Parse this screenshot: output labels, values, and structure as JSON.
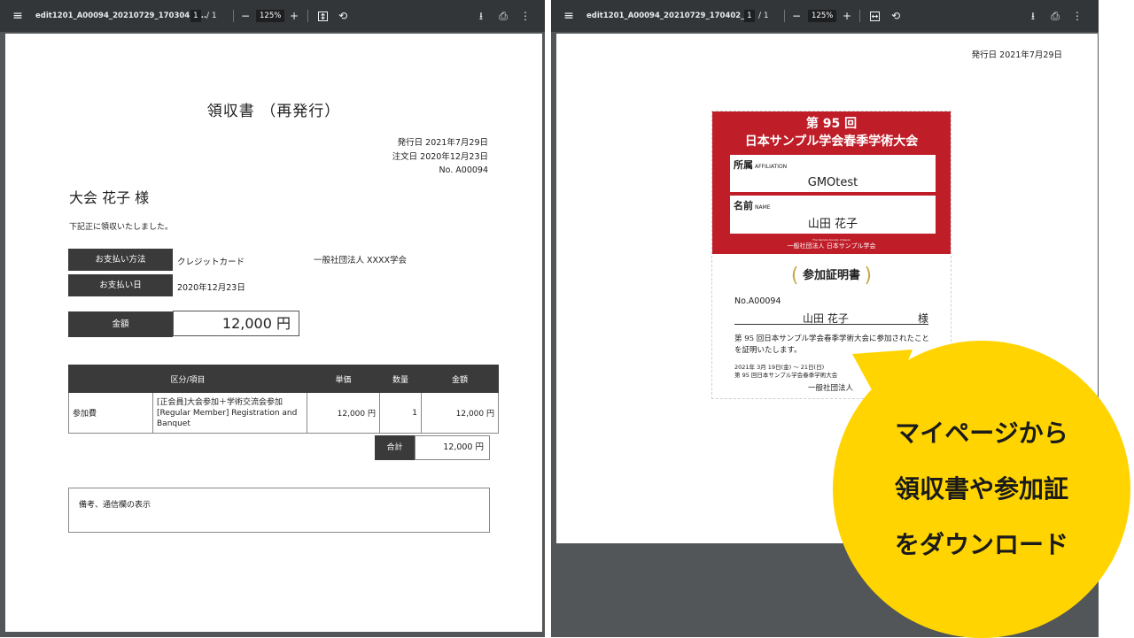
{
  "viewer_left": {
    "filename": "edit1201_A00094_20210729_170304.p...",
    "page_current": "1",
    "page_total": "/  1",
    "zoom": "125%",
    "icons": [
      "menu-icon",
      "zoom-out-icon",
      "zoom-in-icon",
      "fit-page-icon",
      "rotate-icon",
      "download-icon",
      "print-icon",
      "more-icon"
    ]
  },
  "viewer_right": {
    "filename": "edit1201_A00094_20210729_170402_...",
    "page_current": "1",
    "page_total": "/  1",
    "zoom": "125%"
  },
  "receipt": {
    "title": "領収書 （再発行）",
    "issue_date": "発行日 2021年7月29日",
    "order_date": "注文日 2020年12月23日",
    "number": "No. A00094",
    "recipient": "大会 花子 様",
    "note": "下記正に領収いたしました。",
    "payment_method_label": "お支払い方法",
    "payment_method_value": "クレジットカード",
    "issuer": "一般社団法人 XXXX学会",
    "payment_date_label": "お支払い日",
    "payment_date_value": "2020年12月23日",
    "amount_label": "金額",
    "amount_value": "12,000 円",
    "table_headers": [
      "区分/項目",
      "単価",
      "数量",
      "金額"
    ],
    "row": {
      "category": "参加費",
      "item": "[正会員]大会参加＋学術交流会参加 [Regular Member] Registration and Banquet",
      "unit_price": "12,000 円",
      "qty": "1",
      "amount": "12,000 円"
    },
    "total_label": "合計",
    "total_value": "12,000 円",
    "remarks": "備考、通信欄の表示"
  },
  "certificate": {
    "issue_date": "発行日 2021年7月29日",
    "header_line1": "第 95 回",
    "header_line2": "日本サンプル学会春季学術大会",
    "affiliation_label": "所属",
    "affiliation_sub": "AFFILIATION",
    "affiliation_value": "GMOtest",
    "name_label": "名前",
    "name_sub": "NAME",
    "name_value": "山田 花子",
    "small_en": "The Sample Society of Japan",
    "small_jp": "一般社団法人 日本サンプル学会",
    "title": "参加証明書",
    "number": "No.A00094",
    "holder_name": "山田 花子",
    "honorific": "様",
    "body": "第 95 回日本サンプル学会春季学術大会に参加されたことを証明いたします。",
    "date_range": "2021年 3月 19日(金) ～ 21日(日)",
    "event_line": "第 95 回日本サンプル学会春季学術大会",
    "org": "一般社団法人"
  },
  "callout": {
    "line1": "マイページから",
    "line2": "領収書や参加証",
    "line3": "をダウンロード",
    "color": "#ffd400"
  }
}
